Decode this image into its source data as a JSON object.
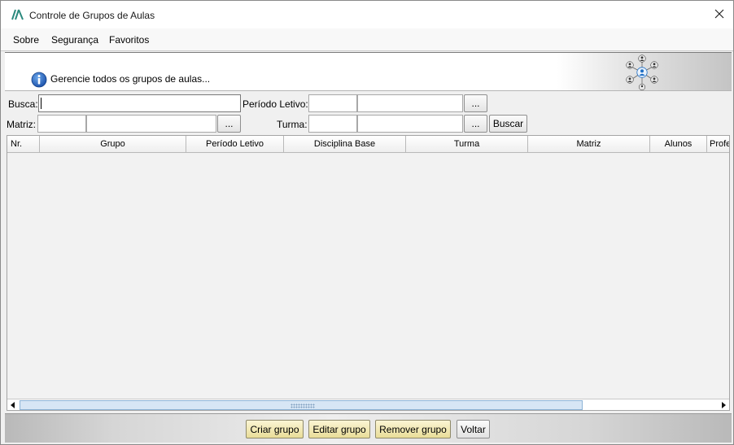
{
  "window": {
    "title": "Controle de Grupos de Aulas",
    "close_glyph": "✕",
    "app_icon": "app-logo-icon"
  },
  "menu": {
    "items": [
      {
        "label": "Sobre"
      },
      {
        "label": "Segurança"
      },
      {
        "label": "Favoritos"
      }
    ]
  },
  "header": {
    "info_text": "Gerencie todos os grupos de aulas...",
    "info_icon": "info-icon",
    "badge_icon": "user-group-network-icon"
  },
  "filters": {
    "busca_label": "Busca:",
    "busca_value": "",
    "periodo_label": "Período Letivo:",
    "periodo_code": "",
    "periodo_name": "",
    "matriz_label": "Matriz:",
    "matriz_code": "",
    "matriz_name": "",
    "turma_label": "Turma:",
    "turma_code": "",
    "turma_name": "",
    "ellipsis_label": "...",
    "buscar_label": "Buscar"
  },
  "table": {
    "columns": [
      "Nr.",
      "Grupo",
      "Período Letivo",
      "Disciplina Base",
      "Turma",
      "Matriz",
      "Alunos",
      "Professor"
    ],
    "rows": []
  },
  "footer": {
    "criar_label": "Criar grupo",
    "editar_label": "Editar grupo",
    "remover_label": "Remover grupo",
    "voltar_label": "Voltar"
  },
  "colors": {
    "accent_blue": "#1f6fc5",
    "button_yellow": "#efe4a6",
    "scroll_thumb": "#d7e6f5"
  }
}
